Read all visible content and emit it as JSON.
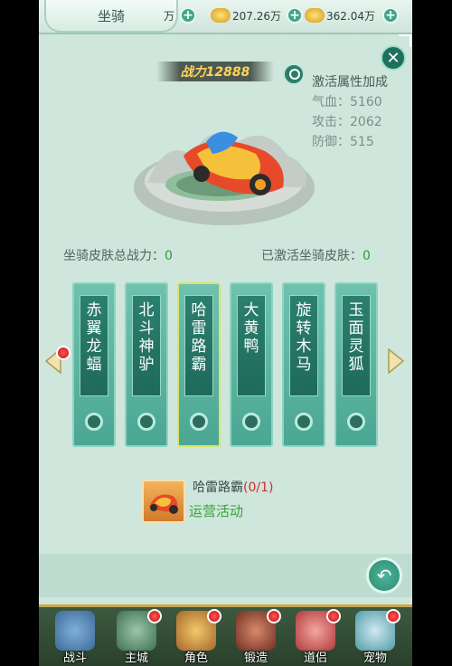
{
  "header": {
    "title": "坐骑",
    "currencies": [
      {
        "value": "万"
      },
      {
        "value": "207.26万"
      },
      {
        "value": "362.04万"
      }
    ]
  },
  "power": {
    "label": "战力12888"
  },
  "attributes": {
    "heading": "激活属性加成",
    "hp": "气血：5160",
    "attack": "攻击：2062",
    "defense": "防御：515"
  },
  "summary": {
    "total_power_label": "坐骑皮肤总战力：",
    "total_power_value": "0",
    "activated_label": "已激活坐骑皮肤：",
    "activated_value": "0"
  },
  "skins": [
    {
      "name": "赤翼龙蝠"
    },
    {
      "name": "北斗神驴"
    },
    {
      "name": "哈雷路霸"
    },
    {
      "name": "大黄鸭"
    },
    {
      "name": "旋转木马"
    },
    {
      "name": "玉面灵狐"
    }
  ],
  "item": {
    "name": "哈雷路霸",
    "count": "(0/1)",
    "source": "运营活动"
  },
  "nav": [
    {
      "label": "战斗"
    },
    {
      "label": "主城"
    },
    {
      "label": "角色"
    },
    {
      "label": "锻造"
    },
    {
      "label": "道侣"
    },
    {
      "label": "宠物"
    }
  ],
  "colors": {
    "accent": "#3ba88a",
    "highlight": "#2e9a3a",
    "alert": "#c9302c"
  }
}
